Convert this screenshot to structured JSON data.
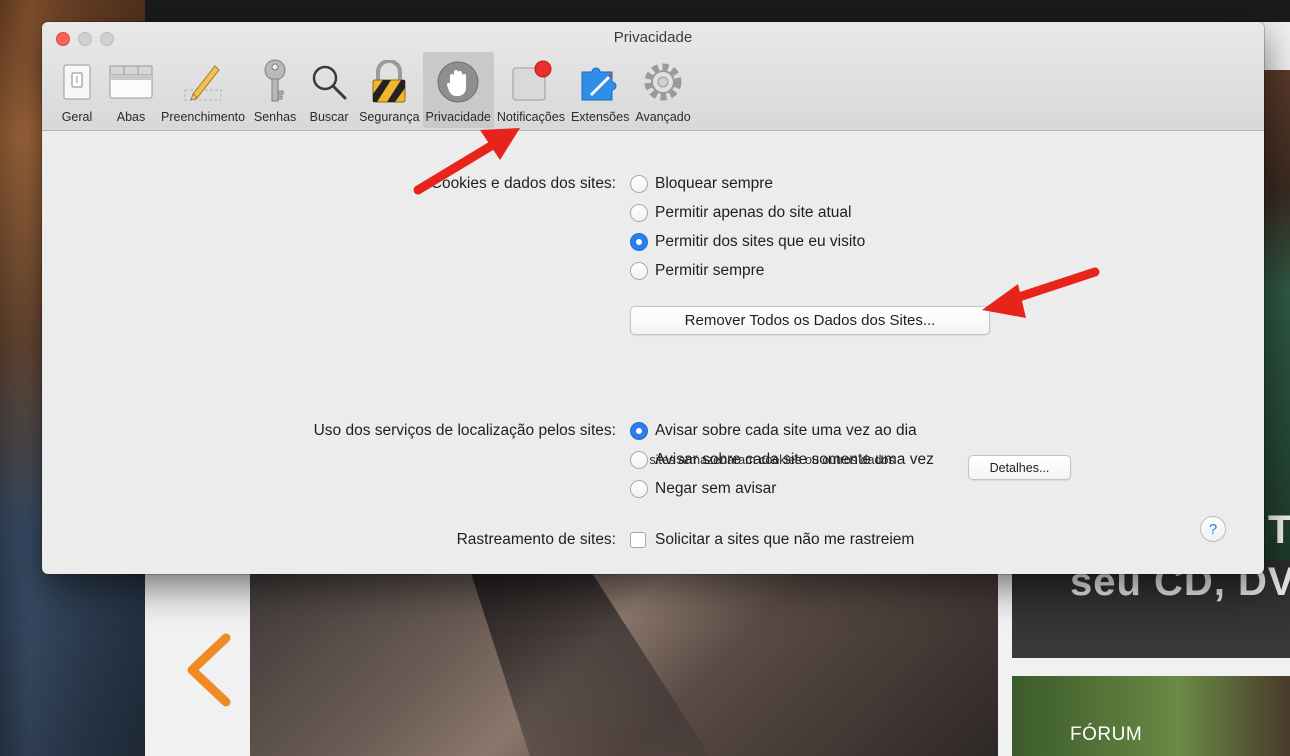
{
  "background": {
    "card_headline": "seu CD, DV",
    "right_strip_text": "T",
    "forum_label": "FÓRUM"
  },
  "window": {
    "title": "Privacidade",
    "toolbar": [
      {
        "label": "Geral",
        "icon": "switch-icon"
      },
      {
        "label": "Abas",
        "icon": "tabs-icon"
      },
      {
        "label": "Preenchimento",
        "icon": "pencil-icon"
      },
      {
        "label": "Senhas",
        "icon": "key-icon"
      },
      {
        "label": "Buscar",
        "icon": "search-icon"
      },
      {
        "label": "Segurança",
        "icon": "lock-icon"
      },
      {
        "label": "Privacidade",
        "icon": "hand-icon",
        "selected": true
      },
      {
        "label": "Notificações",
        "icon": "notification-icon"
      },
      {
        "label": "Extensões",
        "icon": "puzzle-icon"
      },
      {
        "label": "Avançado",
        "icon": "gear-icon"
      }
    ]
  },
  "cookies": {
    "label": "Cookies e dados dos sites:",
    "options": [
      {
        "label": "Bloquear sempre",
        "selected": false
      },
      {
        "label": "Permitir apenas do site atual",
        "selected": false
      },
      {
        "label": "Permitir dos sites que eu visito",
        "selected": true
      },
      {
        "label": "Permitir sempre",
        "selected": false
      }
    ],
    "remove_button": "Remover Todos os Dados dos Sites...",
    "note": "27 sites armazenaram cookies ou outros dados",
    "details_button": "Detalhes..."
  },
  "location": {
    "label": "Uso dos serviços de localização pelos sites:",
    "options": [
      {
        "label": "Avisar sobre cada site uma vez ao dia",
        "selected": true
      },
      {
        "label": "Avisar sobre cada site somente uma vez",
        "selected": false
      },
      {
        "label": "Negar sem avisar",
        "selected": false
      }
    ]
  },
  "tracking": {
    "label": "Rastreamento de sites:",
    "checkbox_label": "Solicitar a sites que não me rastreiem",
    "checked": false
  },
  "help_label": "?",
  "colors": {
    "accent": "#2b7de9",
    "annotation_arrow": "#e8231c",
    "close_button": "#fc605c"
  }
}
